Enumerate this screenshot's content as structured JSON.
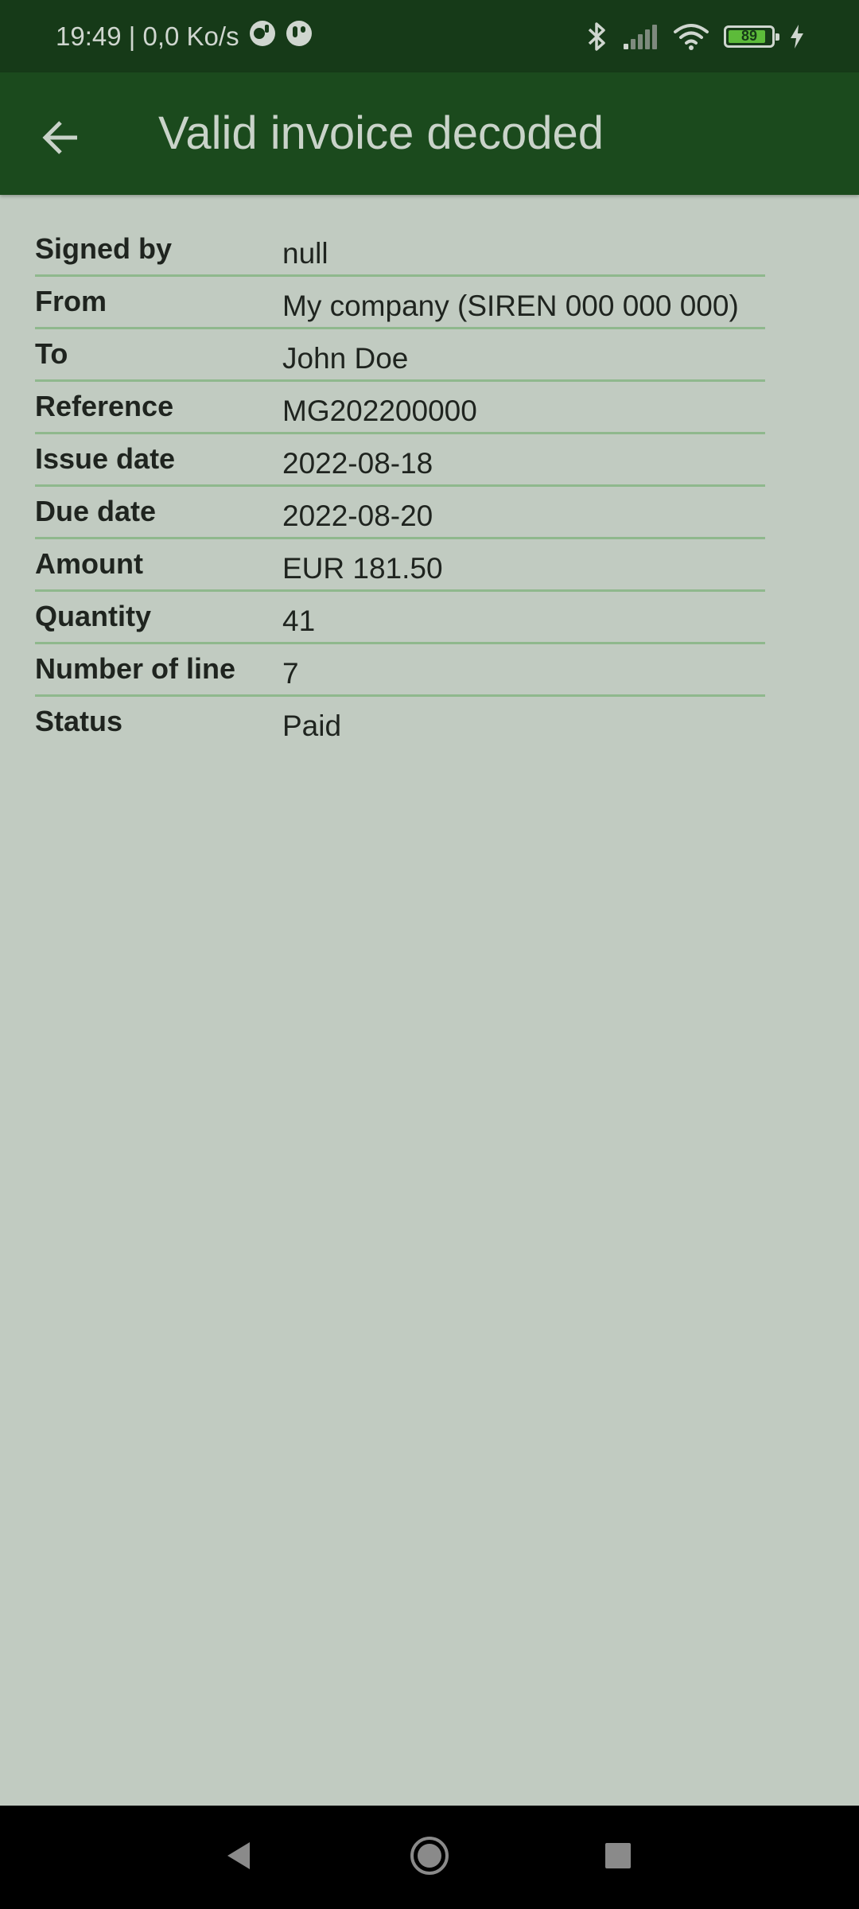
{
  "status_bar": {
    "time_and_speed": "19:49 | 0,0 Ko/s",
    "battery_level": 89,
    "battery_text": "89",
    "icons": [
      "notification-app-icon",
      "notification-app-icon",
      "bluetooth-icon",
      "cell-signal-icon",
      "wifi-icon",
      "battery-icon",
      "charging-icon"
    ]
  },
  "app_bar": {
    "title": "Valid invoice decoded",
    "back_icon": "arrow-left-icon"
  },
  "invoice": {
    "rows": [
      {
        "label": "Signed by",
        "value": "null"
      },
      {
        "label": "From",
        "value": "My company (SIREN 000 000 000)"
      },
      {
        "label": "To",
        "value": "John Doe"
      },
      {
        "label": "Reference",
        "value": "MG202200000"
      },
      {
        "label": "Issue date",
        "value": "2022-08-18"
      },
      {
        "label": "Due date",
        "value": "2022-08-20"
      },
      {
        "label": "Amount",
        "value": "EUR 181.50"
      },
      {
        "label": "Quantity",
        "value": "41"
      },
      {
        "label": "Number of line",
        "value": "7"
      },
      {
        "label": "Status",
        "value": "Paid"
      }
    ]
  },
  "nav_bar": {
    "icons": [
      "back-triangle-icon",
      "home-circle-icon",
      "recents-square-icon"
    ]
  },
  "colors": {
    "status_bar_bg": "#163a18",
    "app_bar_bg": "#1b4a1d",
    "page_bg": "#c1cbc1",
    "divider": "#8fb88d",
    "battery_fill": "#5dbb3a"
  }
}
